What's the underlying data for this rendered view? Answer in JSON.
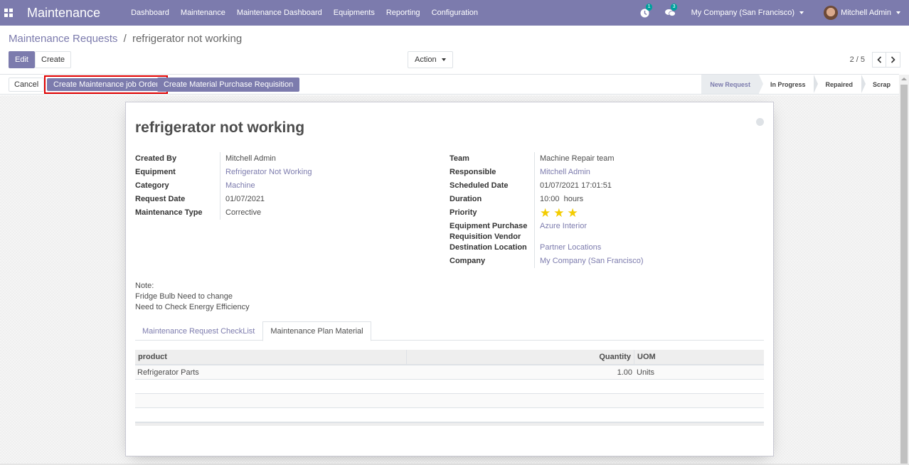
{
  "navbar": {
    "app_name": "Maintenance",
    "menu": [
      "Dashboard",
      "Maintenance",
      "Maintenance Dashboard",
      "Equipments",
      "Reporting",
      "Configuration"
    ],
    "activity_count": "1",
    "messages_count": "3",
    "company": "My Company (San Francisco)",
    "user": "Mitchell Admin"
  },
  "breadcrumb": {
    "parent": "Maintenance Requests",
    "separator": "/",
    "current": "refrigerator not working"
  },
  "control_panel": {
    "edit_label": "Edit",
    "create_label": "Create",
    "action_label": "Action",
    "pager": "2 / 5"
  },
  "statusbar": {
    "cancel_label": "Cancel",
    "job_order_label": "Create Maintenance job Order",
    "purchase_req_label": "Create Material Purchase Requisition",
    "stages": [
      {
        "label": "New Request",
        "active": true
      },
      {
        "label": "In Progress",
        "active": false
      },
      {
        "label": "Repaired",
        "active": false
      },
      {
        "label": "Scrap",
        "active": false
      }
    ]
  },
  "form": {
    "title": "refrigerator not working",
    "left_fields": [
      {
        "label": "Created By",
        "value": "Mitchell Admin",
        "link": false
      },
      {
        "label": "Equipment",
        "value": "Refrigerator Not Working",
        "link": true
      },
      {
        "label": "Category",
        "value": "Machine",
        "link": true
      },
      {
        "label": "Request Date",
        "value": "01/07/2021",
        "link": false
      },
      {
        "label": "Maintenance Type",
        "value": "Corrective",
        "link": false
      }
    ],
    "right_fields": {
      "team": {
        "label": "Team",
        "value": "Machine Repair team"
      },
      "responsible": {
        "label": "Responsible",
        "value": "Mitchell Admin"
      },
      "scheduled_date": {
        "label": "Scheduled Date",
        "value": "01/07/2021 17:01:51"
      },
      "duration": {
        "label": "Duration",
        "value": "10:00  hours"
      },
      "priority": {
        "label": "Priority",
        "stars": 3,
        "max_stars": 3
      },
      "vendor": {
        "label": "Equipment Purchase Requisition Vendor",
        "value": "Azure Interior"
      },
      "destination": {
        "label": "Destination Location",
        "value": "Partner Locations"
      },
      "company": {
        "label": "Company",
        "value": "My Company (San Francisco)"
      }
    },
    "note_lines": [
      "Note:",
      "Fridge Bulb Need to change",
      "Need to Check Energy Efficiency"
    ],
    "tabs": [
      {
        "label": "Maintenance Request CheckList",
        "active": false
      },
      {
        "label": "Maintenance Plan Material",
        "active": true
      }
    ],
    "table": {
      "columns": [
        "product",
        "Quantity",
        "UOM"
      ],
      "rows": [
        {
          "product": "Refrigerator Parts",
          "quantity": "1.00",
          "uom": "Units"
        }
      ]
    }
  }
}
